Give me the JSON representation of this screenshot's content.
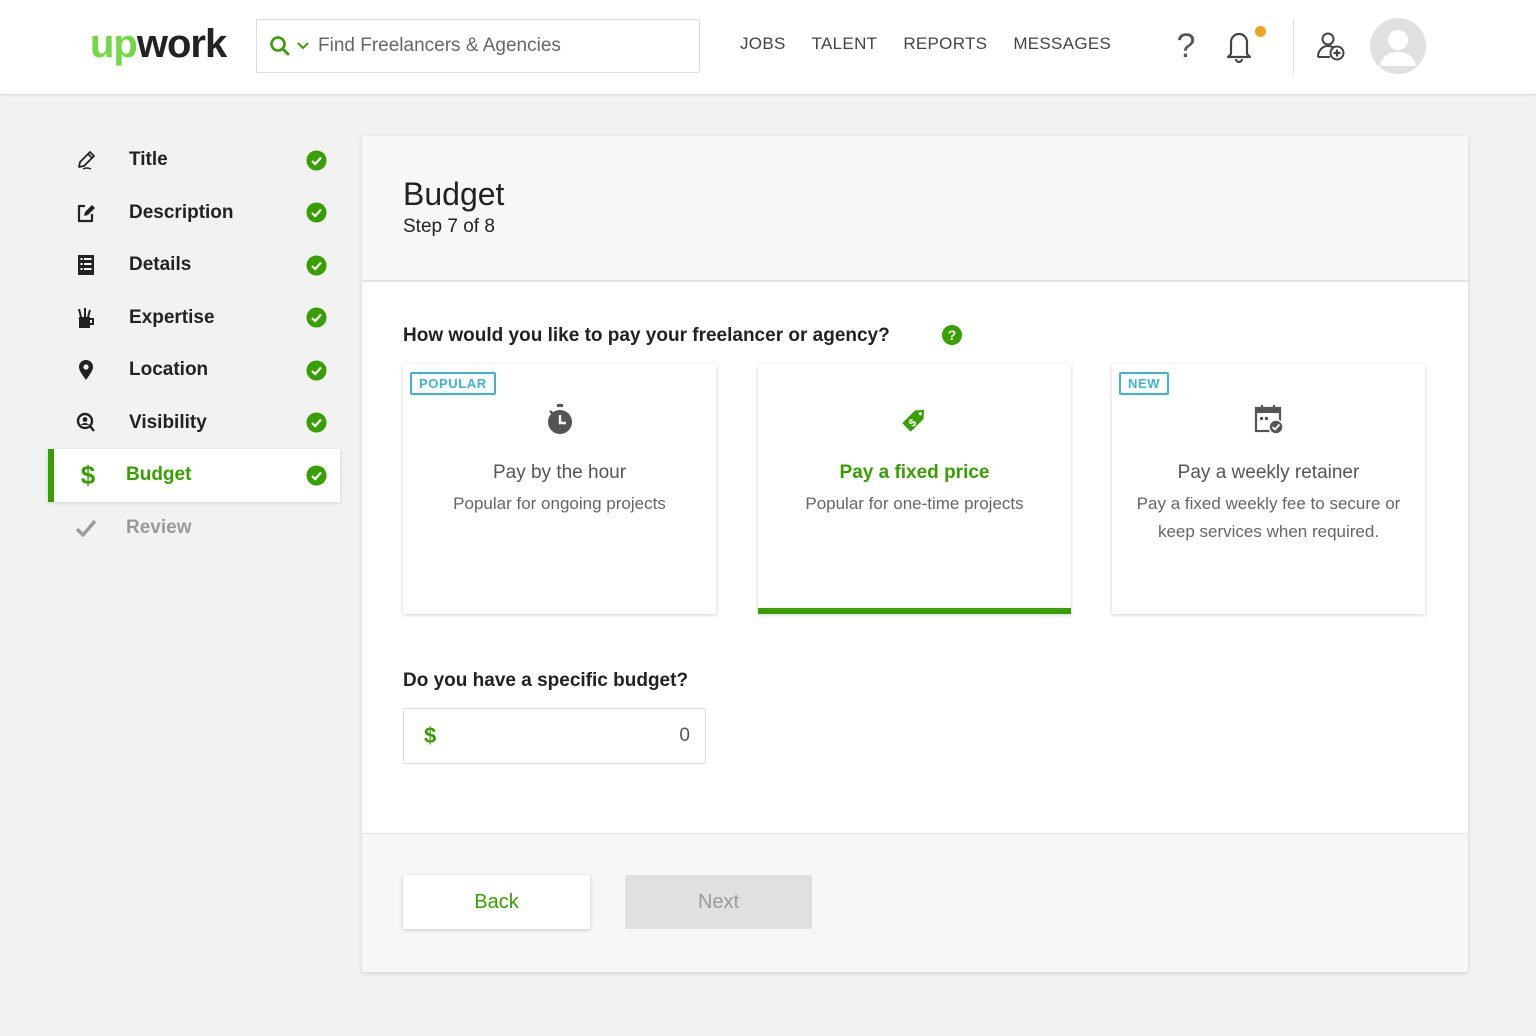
{
  "header": {
    "logo_up": "up",
    "logo_work": "work",
    "search": {
      "placeholder": "Find Freelancers & Agencies",
      "value": ""
    },
    "nav": [
      {
        "label": "JOBS"
      },
      {
        "label": "TALENT"
      },
      {
        "label": "REPORTS"
      },
      {
        "label": "MESSAGES"
      }
    ],
    "help_glyph": "?",
    "notification_dot_color": "#f0a522"
  },
  "sidebar": {
    "items": [
      {
        "label": "Title",
        "icon": "pencil-icon",
        "status": "complete"
      },
      {
        "label": "Description",
        "icon": "edit-icon",
        "status": "complete"
      },
      {
        "label": "Details",
        "icon": "list-icon",
        "status": "complete"
      },
      {
        "label": "Expertise",
        "icon": "tools-cup-icon",
        "status": "complete"
      },
      {
        "label": "Location",
        "icon": "map-pin-icon",
        "status": "complete"
      },
      {
        "label": "Visibility",
        "icon": "user-search-icon",
        "status": "complete"
      },
      {
        "label": "Budget",
        "icon": "dollar-icon",
        "icon_glyph": "$",
        "status": "active"
      },
      {
        "label": "Review",
        "icon": "checkmark-icon",
        "status": "disabled"
      }
    ]
  },
  "main": {
    "title": "Budget",
    "step": "Step 7 of 8",
    "payment_question": "How would you like to pay your freelancer or agency?",
    "help_glyph": "?",
    "payment_options": [
      {
        "badge": "POPULAR",
        "icon": "stopwatch-icon",
        "title": "Pay by the hour",
        "description": "Popular for ongoing projects",
        "selected": false
      },
      {
        "badge": "",
        "icon": "price-tag-icon",
        "title": "Pay a fixed price",
        "description": "Popular for one-time projects",
        "selected": true
      },
      {
        "badge": "NEW",
        "icon": "calendar-check-icon",
        "title": "Pay a weekly retainer",
        "description": "Pay a fixed weekly fee to secure or keep services when required.",
        "selected": false
      }
    ],
    "budget_question": "Do you have a specific budget?",
    "budget_currency": "$",
    "budget_value": "0",
    "back_label": "Back",
    "next_label": "Next"
  },
  "colors": {
    "brand_green": "#37a000",
    "logo_green": "#6fda44",
    "badge_blue": "#3bb4d8",
    "check_green": "#37a000"
  }
}
